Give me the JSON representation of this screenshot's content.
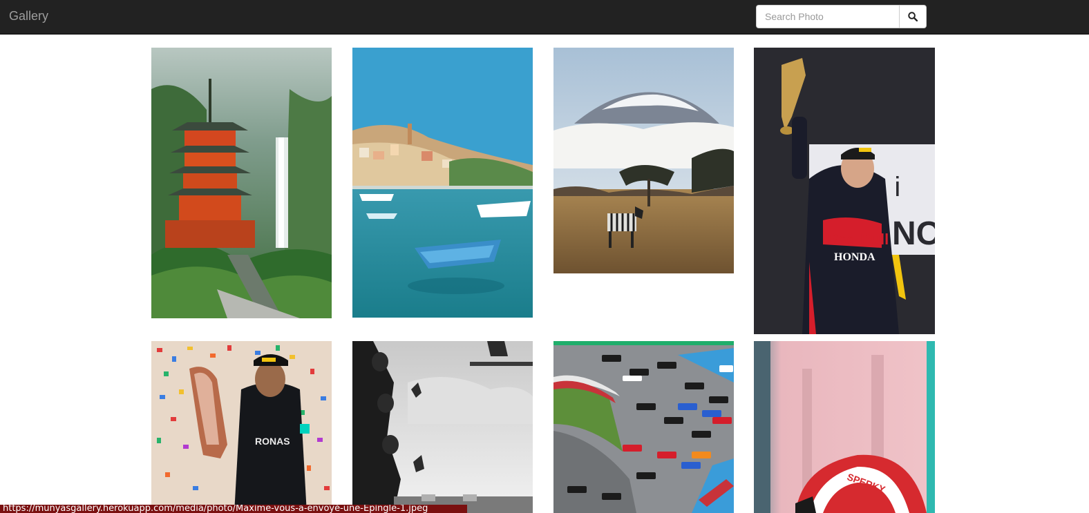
{
  "navbar": {
    "brand": "Gallery",
    "search_placeholder": "Search Photo",
    "search_icon": "search-icon"
  },
  "photos": [
    {
      "name": "photo-japan-pagoda-waterfall"
    },
    {
      "name": "photo-greek-harbor-boats"
    },
    {
      "name": "photo-kilimanjaro-zebra"
    },
    {
      "name": "photo-verstappen-trophy"
    },
    {
      "name": "photo-hamilton-trophy-confetti"
    },
    {
      "name": "photo-pitwall-celebration-bw"
    },
    {
      "name": "photo-f1-race-start"
    },
    {
      "name": "photo-leclerc-helmet"
    }
  ],
  "status_bar": {
    "url": "https://munyasgallery.herokuapp.com/media/photo/Maxime-vous-a-envoyé-une-Épingle-1.jpeg"
  }
}
